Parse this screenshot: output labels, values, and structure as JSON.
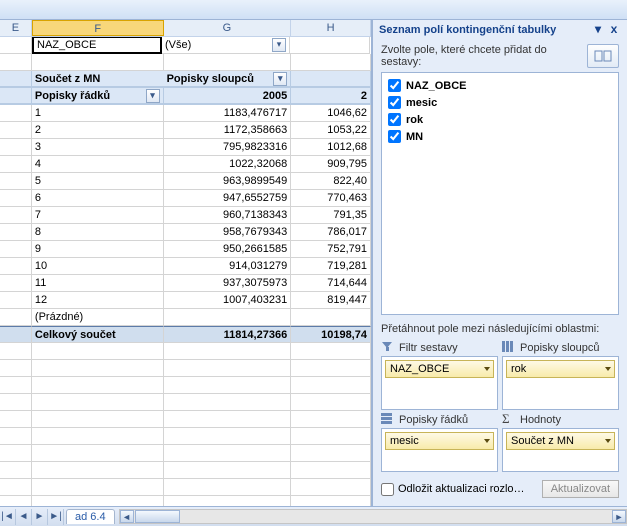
{
  "columns": {
    "E": "E",
    "F": "F",
    "G": "G",
    "H": "H"
  },
  "pivot": {
    "page_field_name": "NAZ_OBCE",
    "page_field_value": "(Vše)",
    "data_field_label": "Součet z MN",
    "col_labels_label": "Popisky sloupců",
    "row_labels_label": "Popisky řádků",
    "first_col_year": "2005",
    "blank_label": "(Prázdné)",
    "grand_total_label": "Celkový součet",
    "grand_total_g": "11814,27366",
    "grand_total_h": "10198,74",
    "next_year_partial": "2"
  },
  "rows": [
    {
      "r": "1",
      "g": "1183,476717",
      "h": "1046,62"
    },
    {
      "r": "2",
      "g": "1172,358663",
      "h": "1053,22"
    },
    {
      "r": "3",
      "g": "795,9823316",
      "h": "1012,68"
    },
    {
      "r": "4",
      "g": "1022,32068",
      "h": "909,795"
    },
    {
      "r": "5",
      "g": "963,9899549",
      "h": "822,40"
    },
    {
      "r": "6",
      "g": "947,6552759",
      "h": "770,463"
    },
    {
      "r": "7",
      "g": "960,7138343",
      "h": "791,35"
    },
    {
      "r": "8",
      "g": "958,7679343",
      "h": "786,017"
    },
    {
      "r": "9",
      "g": "950,2661585",
      "h": "752,791"
    },
    {
      "r": "10",
      "g": "914,031279",
      "h": "719,281"
    },
    {
      "r": "11",
      "g": "937,3075973",
      "h": "714,644"
    },
    {
      "r": "12",
      "g": "1007,403231",
      "h": "819,447"
    }
  ],
  "panel": {
    "title": "Seznam polí kontingenční tabulky",
    "choose_text": "Zvolte pole, které chcete přidat do sestavy:",
    "fields": [
      {
        "name": "NAZ_OBCE",
        "checked": true
      },
      {
        "name": "mesic",
        "checked": true
      },
      {
        "name": "rok",
        "checked": true
      },
      {
        "name": "MN",
        "checked": true
      }
    ],
    "drag_caption": "Přetáhnout pole mezi následujícími oblastmi:",
    "area_filter_label": "Filtr sestavy",
    "area_cols_label": "Popisky sloupců",
    "area_rows_label": "Popisky řádků",
    "area_values_label": "Hodnoty",
    "area_filter_chip": "NAZ_OBCE",
    "area_cols_chip": "rok",
    "area_rows_chip": "mesic",
    "area_values_chip": "Součet z MN",
    "defer_label": "Odložit aktualizaci rozlo…",
    "update_btn": "Aktualizovat"
  },
  "sheet_tab": "ad 6.4",
  "glyphs": {
    "tri": "▾",
    "x": "x",
    "left": "◄",
    "right": "►",
    "lend": "|◄",
    "rend": "►|",
    "sigma": "Σ"
  }
}
